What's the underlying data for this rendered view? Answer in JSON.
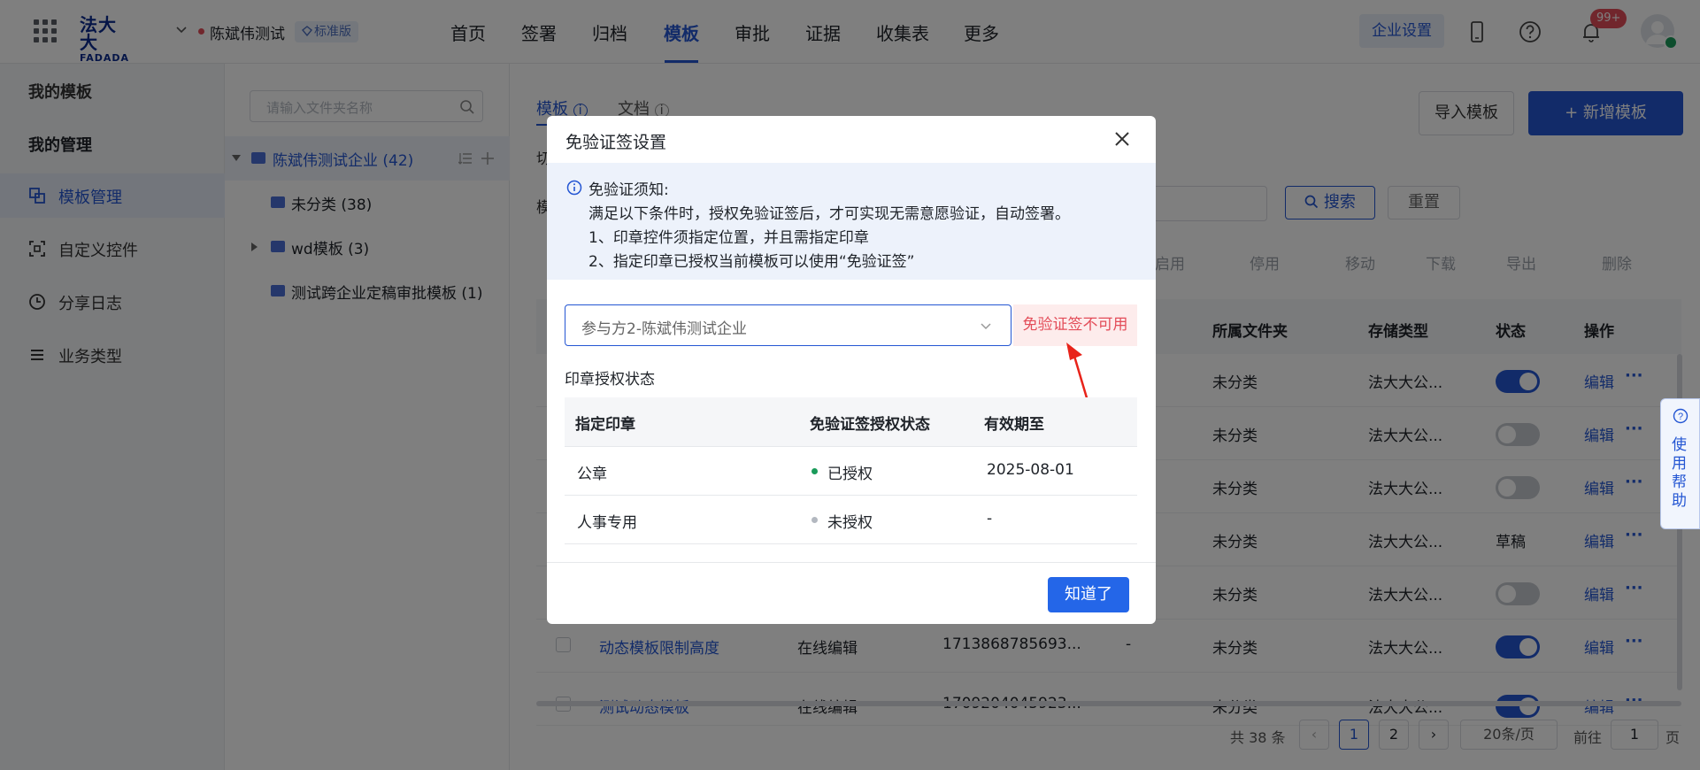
{
  "topbar": {
    "logo_main": "法大大",
    "logo_sub": "FADADA",
    "company": "陈斌伟测试",
    "edition": "标准版",
    "nav": [
      "首页",
      "签署",
      "归档",
      "模板",
      "审批",
      "证据",
      "收集表",
      "更多"
    ],
    "active_nav": "模板",
    "enterprise_settings": "企业设置",
    "notification_count": "99+"
  },
  "sidebar": {
    "section1": "我的模板",
    "section2": "我的管理",
    "items": [
      {
        "label": "模板管理",
        "icon": "template-manage-icon"
      },
      {
        "label": "自定义控件",
        "icon": "custom-control-icon"
      },
      {
        "label": "分享日志",
        "icon": "clock-icon"
      },
      {
        "label": "业务类型",
        "icon": "list-icon"
      }
    ]
  },
  "tree": {
    "search_placeholder": "请输入文件夹名称",
    "root": "陈斌伟测试企业 (42)",
    "children": [
      "未分类 (38)",
      "wd模板 (3)",
      "测试跨企业定稿审批模板 (1)"
    ]
  },
  "main": {
    "tab_template": "模板",
    "tab_document": "文档",
    "import_btn": "导入模板",
    "new_btn": "+ 新增模板",
    "search_btn": "搜索",
    "reset_btn": "重置",
    "toolbar": [
      "启用",
      "停用",
      "移动",
      "下载",
      "导出",
      "删除"
    ],
    "columns": [
      "所属文件夹",
      "存储类型",
      "状态",
      "操作"
    ],
    "rows": [
      {
        "folder": "未分类",
        "storage": "法大大公...",
        "status": "on",
        "action": "编辑"
      },
      {
        "folder": "未分类",
        "storage": "法大大公...",
        "status": "off",
        "action": "编辑"
      },
      {
        "folder": "未分类",
        "storage": "法大大公...",
        "status": "off",
        "action": "编辑"
      },
      {
        "folder": "未分类",
        "storage": "法大大公...",
        "status": "草稿",
        "action": "编辑"
      },
      {
        "folder": "未分类",
        "storage": "法大大公...",
        "status": "off",
        "action": "编辑"
      },
      {
        "name": "动态模板限制高度",
        "type": "在线编辑",
        "id": "1713868785693...",
        "tag": "-",
        "folder": "未分类",
        "storage": "法大大公...",
        "status": "on",
        "action": "编辑"
      },
      {
        "name": "测试动态模板",
        "type": "在线编辑",
        "id": "1709204045923...",
        "tag": "-",
        "folder": "未分类",
        "storage": "法大大公...",
        "status": "on",
        "action": "编辑"
      }
    ],
    "pager": {
      "total": "共 38 条",
      "current": "1",
      "page2": "2",
      "page_size": "20条/页",
      "goto_label": "前往",
      "goto_value": "1",
      "page_suffix": "页"
    },
    "help_tab": "使用帮助"
  },
  "dialog": {
    "title": "免验证签设置",
    "notice_title": "免验证须知:",
    "notice_line1": "满足以下条件时，授权免验证签后，才可实现无需意愿验证，自动签署。",
    "notice_line2": "1、印章控件须指定位置，并且需指定印章",
    "notice_line3": "2、指定印章已授权当前模板可以使用“免验证签”",
    "select_value": "参与方2-陈斌伟测试企业",
    "warning": "免验证签不可用",
    "section_title": "印章授权状态",
    "table_headers": [
      "指定印章",
      "免验证签授权状态",
      "有效期至"
    ],
    "table_rows": [
      {
        "seal": "公章",
        "status": "已授权",
        "status_color": "#1a9b5a",
        "expiry": "2025-08-01"
      },
      {
        "seal": "人事专用",
        "status": "未授权",
        "status_color": "#b3b8c0",
        "expiry": "-"
      }
    ],
    "ok_button": "知道了"
  },
  "colors": {
    "primary": "#2456d3",
    "warning": "#e34d59",
    "success": "#1a9b5a",
    "button": "#2466e8"
  }
}
